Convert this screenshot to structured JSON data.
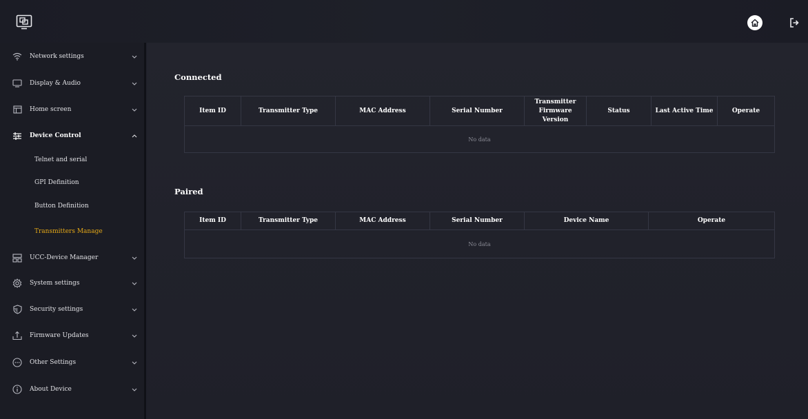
{
  "header": {
    "logo_icon": "screen-share-icon",
    "home_icon": "home-icon",
    "logout_icon": "logout-icon"
  },
  "sidebar": {
    "items": [
      {
        "label": "Network settings",
        "icon": "wifi-icon",
        "expanded": false
      },
      {
        "label": "Display & Audio",
        "icon": "monitor-icon",
        "expanded": false
      },
      {
        "label": "Home screen",
        "icon": "home-screen-icon",
        "expanded": false
      },
      {
        "label": "Device Control",
        "icon": "sliders-icon",
        "expanded": true
      },
      {
        "label": "UCC-Device Manager",
        "icon": "device-manager-icon",
        "expanded": false
      },
      {
        "label": "System settings",
        "icon": "gear-icon",
        "expanded": false
      },
      {
        "label": "Security settings",
        "icon": "shield-icon",
        "expanded": false
      },
      {
        "label": "Firmware Updates",
        "icon": "upload-icon",
        "expanded": false
      },
      {
        "label": "Other Settings",
        "icon": "more-icon",
        "expanded": false
      },
      {
        "label": "About Device",
        "icon": "info-icon",
        "expanded": false
      }
    ],
    "device_control_subitems": [
      {
        "label": "Telnet and serial",
        "active": false
      },
      {
        "label": "GPI Definition",
        "active": false
      },
      {
        "label": "Button Definition",
        "active": false
      },
      {
        "label": "Transmitters Manage",
        "active": true
      }
    ]
  },
  "main": {
    "connected": {
      "title": "Connected",
      "columns": [
        "Item ID",
        "Transmitter Type",
        "MAC Address",
        "Serial Number",
        "Transmitter Firmware Version",
        "Status",
        "Last Active Time",
        "Operate"
      ],
      "empty_text": "No data"
    },
    "paired": {
      "title": "Paired",
      "columns": [
        "Item ID",
        "Transmitter Type",
        "MAC Address",
        "Serial Number",
        "Device Name",
        "Operate"
      ],
      "empty_text": "No data"
    }
  },
  "colors": {
    "accent": "#e6a917",
    "background": "#20212b",
    "sidebar": "#1b1c24"
  }
}
